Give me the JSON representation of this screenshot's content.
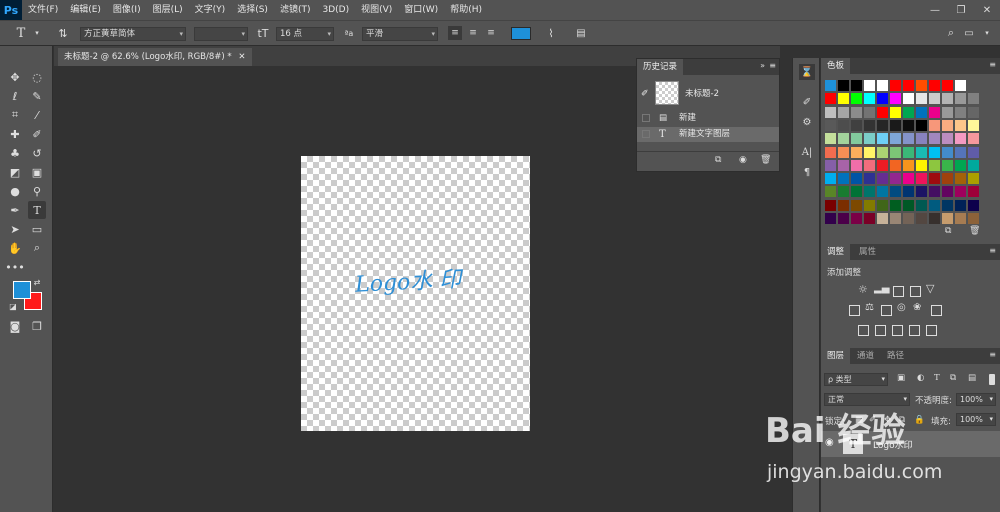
{
  "app": {
    "logo": "Ps"
  },
  "menu": [
    "文件(F)",
    "编辑(E)",
    "图像(I)",
    "图层(L)",
    "文字(Y)",
    "选择(S)",
    "滤镜(T)",
    "3D(D)",
    "视图(V)",
    "窗口(W)",
    "帮助(H)"
  ],
  "window_controls": {
    "minimize": "—",
    "restore": "❐",
    "close": "✕"
  },
  "options": {
    "font_family": "方正黄草简体",
    "font_style": "",
    "font_size": "16 点",
    "aa_label": "ªa",
    "antialias": "平滑",
    "text_color": "#1e90d8"
  },
  "document": {
    "tab_title": "未标题-2 @ 62.6% (Logo水印, RGB/8#) *",
    "close": "✕",
    "canvas_text": "Logo水 印"
  },
  "colors": {
    "foreground": "#1e90d8",
    "background": "#ff1a1a",
    "accent": "#31a8ff"
  },
  "history": {
    "tab": "历史记录",
    "snapshot": "未标题-2",
    "items": [
      {
        "label": "新建",
        "icon": "document-icon"
      },
      {
        "label": "新建文字图层",
        "icon": "type-icon"
      }
    ]
  },
  "swatches_panel": {
    "tab": "色板",
    "rows": [
      [
        "#1e90d8",
        "#000000",
        "#000000",
        "#ffffff",
        "#ffffff",
        "#ff0000",
        "#ff0000",
        "#ff4d00",
        "#ff0000",
        "#ff0000",
        "#ffffff"
      ],
      [
        "#ff0000",
        "#ffff00",
        "#00ff00",
        "#00ffff",
        "#0000ff",
        "#ff00ff",
        "#ffffff",
        "#e6e6e6",
        "#cccccc",
        "#b3b3b3",
        "#999999",
        "#808080"
      ],
      [
        "#bfbfbf",
        "#a6a6a6",
        "#8c8c8c",
        "#737373",
        "#ff0000",
        "#ffff00",
        "#00a651",
        "#0072bc",
        "#ec008c",
        "#999999",
        "#808080",
        "#666666"
      ],
      [
        "#595959",
        "#4d4d4d",
        "#404040",
        "#333333",
        "#262626",
        "#1a1a1a",
        "#0d0d0d",
        "#000000",
        "#f7977a",
        "#f9ad81",
        "#fdc68a",
        "#fff79a"
      ],
      [
        "#c4df9b",
        "#a3d39c",
        "#82ca9d",
        "#7bcdc8",
        "#6ecff6",
        "#7ea7d8",
        "#8493ca",
        "#8882be",
        "#a187be",
        "#bc8dbf",
        "#f49ac2",
        "#f6989d"
      ],
      [
        "#f26c4f",
        "#f68e55",
        "#fbaf5c",
        "#fff467",
        "#acd372",
        "#7cc576",
        "#3bb878",
        "#1abbb4",
        "#00bff3",
        "#438ccb",
        "#5574b9",
        "#605ca8"
      ],
      [
        "#855fa8",
        "#a763a8",
        "#f06ea9",
        "#f26d7d",
        "#ed1c24",
        "#f26522",
        "#f7941d",
        "#fff200",
        "#8dc63f",
        "#39b54a",
        "#00a651",
        "#00a99d"
      ],
      [
        "#00aeef",
        "#0072bc",
        "#0054a6",
        "#2e3192",
        "#662d91",
        "#92278f",
        "#ec008c",
        "#ed145b",
        "#9e0b0f",
        "#a0410d",
        "#a36209",
        "#aba000"
      ],
      [
        "#598527",
        "#197b30",
        "#007236",
        "#00746b",
        "#0076a3",
        "#004b80",
        "#003471",
        "#1b1464",
        "#440e62",
        "#630460",
        "#9e005d",
        "#9e0039"
      ],
      [
        "#790000",
        "#7b2e00",
        "#7d4900",
        "#827b00",
        "#406618",
        "#005e20",
        "#005826",
        "#005952",
        "#005b7f",
        "#003663",
        "#002157",
        "#0d004c"
      ],
      [
        "#32004b",
        "#4b0049",
        "#7b0046",
        "#7a0026",
        "#c7b299",
        "#998675",
        "#736357",
        "#534741",
        "#37302d",
        "#c69c6d",
        "#a67c52",
        "#8c6239"
      ]
    ]
  },
  "adjustments": {
    "tab": "调整",
    "tab2": "属性",
    "title": "添加调整"
  },
  "layers": {
    "tabs": [
      "图层",
      "通道",
      "路径"
    ],
    "filter": "ρ 类型",
    "blend": "正常",
    "opacity_label": "不透明度:",
    "opacity": "100%",
    "lock_label": "锁定:",
    "fill_label": "填充:",
    "fill": "100%",
    "layer_name": "Logo水印"
  },
  "watermark": {
    "logo": "Bai 经验",
    "url": "jingyan.baidu.com"
  }
}
